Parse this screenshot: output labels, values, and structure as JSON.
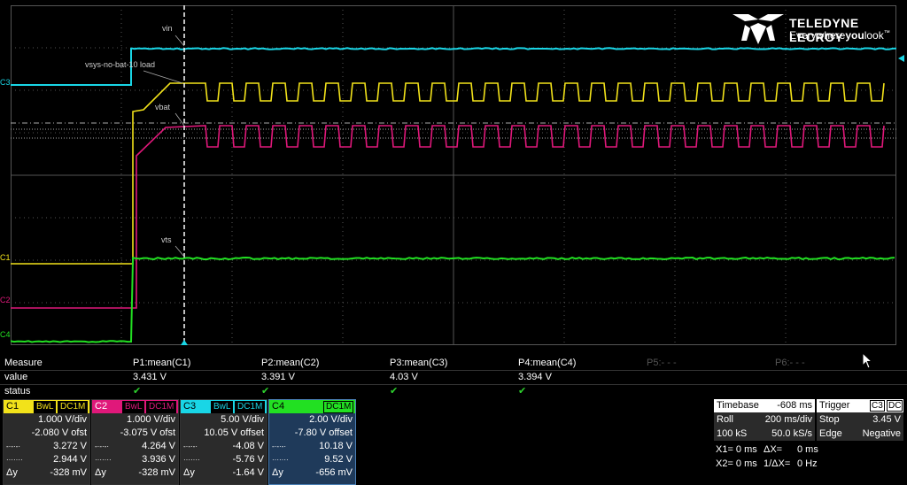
{
  "scope": {
    "brand": "TELEDYNE LECROY",
    "tagline_a": "Everywhere",
    "tagline_b": "you",
    "tagline_c": "look",
    "tagline_tm": "™",
    "trace_labels": {
      "vin": "vin",
      "load": "vsys-no-bat-10 load",
      "vbat": "vbat",
      "vts": "vts"
    },
    "channel_markers": {
      "c3": "C3",
      "c1": "C1",
      "c2": "C2",
      "c4": "C4"
    }
  },
  "colors": {
    "c1": "#f2e21a",
    "c2": "#e0187a",
    "c3": "#19d6e6",
    "c4": "#22e022",
    "grid": "#555555"
  },
  "measure": {
    "row_labels": [
      "Measure",
      "value",
      "status"
    ],
    "params": [
      {
        "name": "P1:mean(C1)",
        "value": "3.431 V",
        "status": "✔"
      },
      {
        "name": "P2:mean(C2)",
        "value": "3.391 V",
        "status": "✔"
      },
      {
        "name": "P3:mean(C3)",
        "value": "4.03 V",
        "status": "✔"
      },
      {
        "name": "P4:mean(C4)",
        "value": "3.394 V",
        "status": "✔"
      },
      {
        "name": "P5:- - -",
        "value": "",
        "status": ""
      },
      {
        "name": "P6:- - -",
        "value": "",
        "status": ""
      }
    ]
  },
  "channels": [
    {
      "id": "C1",
      "tags": [
        "BwL",
        "DC1M"
      ],
      "vdiv": "1.000 V/div",
      "offset": "-2.080 V ofst",
      "c1": "3.272 V",
      "c2": "2.944 V",
      "dy": "-328 mV"
    },
    {
      "id": "C2",
      "tags": [
        "BwL",
        "DC1M"
      ],
      "vdiv": "1.000 V/div",
      "offset": "-3.075 V ofst",
      "c1": "4.264 V",
      "c2": "3.936 V",
      "dy": "-328 mV"
    },
    {
      "id": "C3",
      "tags": [
        "BwL",
        "DC1M"
      ],
      "vdiv": "5.00 V/div",
      "offset": "10.05 V offset",
      "c1": "-4.08 V",
      "c2": "-5.76 V",
      "dy": "-1.64 V"
    },
    {
      "id": "C4",
      "tags": [
        "DC1M"
      ],
      "vdiv": "2.00 V/div",
      "offset": "-7.80 V offset",
      "c1": "10.18 V",
      "c2": "9.52 V",
      "dy": "-656 mV"
    }
  ],
  "cursor_glyphs": {
    "c1": "-·-·-·",
    "c2": "·······",
    "dy": "Δy"
  },
  "timebase": {
    "label": "Timebase",
    "value": "-608 ms",
    "mode": "Roll",
    "div": "200 ms/div",
    "samples": "100 kS",
    "rate": "50.0 kS/s"
  },
  "trigger": {
    "label": "Trigger",
    "source": "C3",
    "coupling": "DC",
    "state": "Stop",
    "level": "3.45 V",
    "type": "Edge",
    "slope": "Negative"
  },
  "xcursors": {
    "x1": "X1= 0 ms",
    "dx": "ΔX=",
    "dx_val": "0 ms",
    "x2": "X2= 0 ms",
    "inv": "1/ΔX=",
    "inv_val": "0 Hz"
  }
}
